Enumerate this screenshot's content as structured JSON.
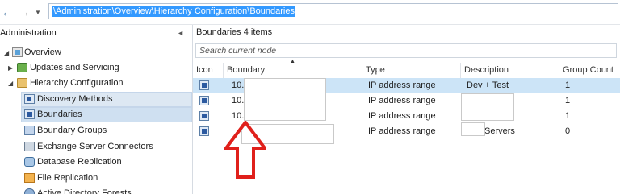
{
  "address_bar": {
    "path": "\\Administration\\Overview\\Hierarchy Configuration\\Boundaries",
    "back_icon": "arrow-left-icon",
    "forward_icon": "arrow-right-icon",
    "dropdown_icon": "chevron-down-icon"
  },
  "navigation": {
    "header": "Administration",
    "collapse_icon": "chevron-left-icon",
    "items": [
      {
        "label": "Overview",
        "icon": "overview-icon",
        "expander": "▲",
        "level": 0
      },
      {
        "label": "Updates and Servicing",
        "icon": "updates-icon",
        "expander": "▶",
        "level": 1
      },
      {
        "label": "Hierarchy Configuration",
        "icon": "folder-icon",
        "expander": "◢",
        "level": 1
      },
      {
        "label": "Discovery Methods",
        "icon": "discovery-icon",
        "level": 2
      },
      {
        "label": "Boundaries",
        "icon": "boundary-icon",
        "level": 2,
        "selected": true
      },
      {
        "label": "Boundary Groups",
        "icon": "boundary-groups-icon",
        "level": 2
      },
      {
        "label": "Exchange Server Connectors",
        "icon": "exchange-icon",
        "level": 2
      },
      {
        "label": "Database Replication",
        "icon": "database-icon",
        "level": 2
      },
      {
        "label": "File Replication",
        "icon": "file-replication-icon",
        "level": 2
      },
      {
        "label": "Active Directory Forests",
        "icon": "ad-forest-icon",
        "level": 2
      }
    ]
  },
  "content": {
    "title": "Boundaries 4 items",
    "search_placeholder": "Search current node",
    "columns": [
      "Icon",
      "Boundary",
      "Type",
      "Description",
      "Group Count"
    ],
    "rows": [
      {
        "boundary": "10.1",
        "type": "IP address range",
        "description": "Dev + Test",
        "group_count": "1",
        "selected": true
      },
      {
        "boundary": "10.1",
        "type": "IP address range",
        "description": "",
        "group_count": "1"
      },
      {
        "boundary": "10.1",
        "type": "IP address range",
        "description": "",
        "group_count": "1"
      },
      {
        "boundary": "",
        "type": "IP address range",
        "description": "Servers",
        "group_count": "0"
      }
    ]
  },
  "annotation": {
    "arrow_color": "#e0201b",
    "arrow_icon": "up-arrow-annotation-icon"
  }
}
